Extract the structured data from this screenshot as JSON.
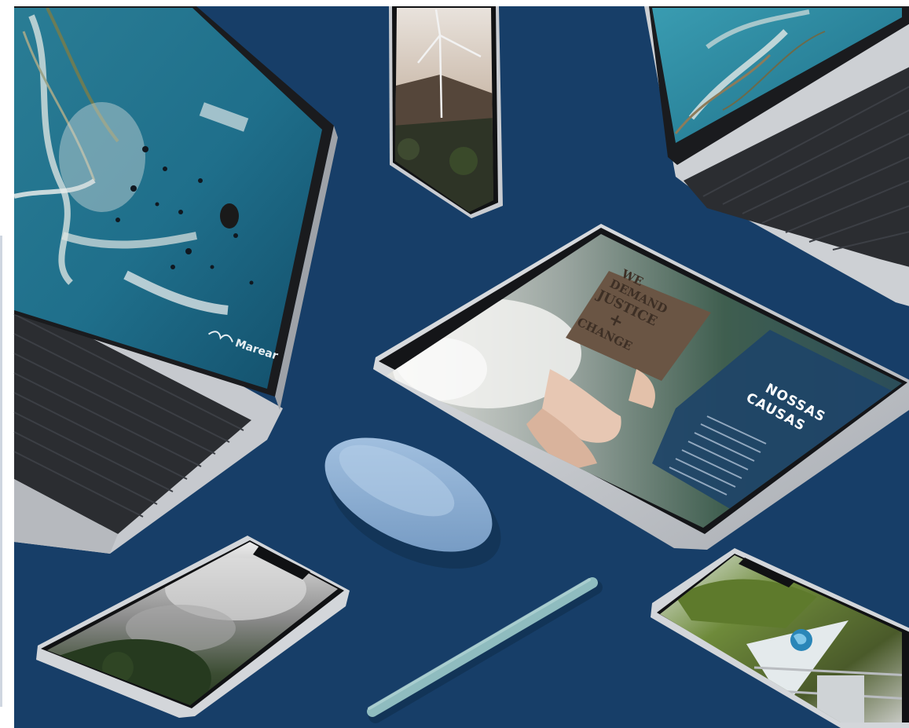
{
  "scene": {
    "background_color": "#173e68",
    "device_silver": "#c9ccd1",
    "mouse_color": "#8fb0d3",
    "pencil_color": "#8fbcbf"
  },
  "tablet": {
    "heading_line1": "NOSSAS",
    "heading_line2": "CAUSAS",
    "sign_line1": "WE",
    "sign_line2": "DEMAND",
    "sign_line3": "JUSTICE",
    "sign_line4": "+",
    "sign_line5": "CHANGE"
  },
  "laptop_left": {
    "logo_text": "Marear"
  },
  "icons": [
    "wind-turbine-icon",
    "globe-flag-icon"
  ]
}
